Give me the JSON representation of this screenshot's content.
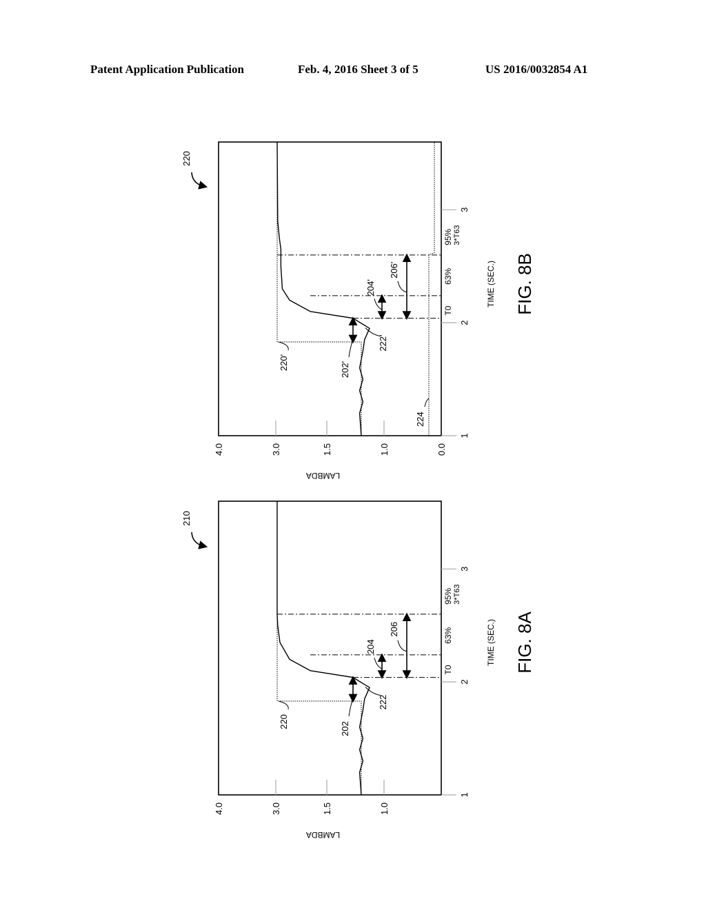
{
  "header": {
    "publication": "Patent Application Publication",
    "date_sheet": "Feb. 4, 2016   Sheet 3 of 5",
    "number": "US 2016/0032854 A1"
  },
  "chart_data": [
    {
      "type": "line",
      "figure": "FIG. 8B",
      "ref": "220",
      "orientation": "rotated 90 degrees counter-clockwise",
      "xlabel": "TIME (SEC.)",
      "ylabel": "LAMBDA",
      "x_ticks": [
        "1",
        "2",
        "3"
      ],
      "y_ticks": [
        "4.0",
        "3.0",
        "1.5",
        "1.0",
        "0.0"
      ],
      "xlim": [
        1,
        3.6
      ],
      "markers": [
        {
          "label": "T0",
          "x": 2.04
        },
        {
          "label": "63%",
          "x": 2.24
        },
        {
          "label": "95%",
          "sub": "3*T63",
          "x": 2.6
        }
      ],
      "series": [
        {
          "name": "220'",
          "style": "dotted",
          "points": [
            [
              1,
              1.2
            ],
            [
              1.83,
              1.2
            ],
            [
              1.83,
              2.9
            ],
            [
              3.6,
              2.9
            ]
          ]
        },
        {
          "name": "222'",
          "style": "solid",
          "points": [
            [
              1,
              1.2
            ],
            [
              1.2,
              1.22
            ],
            [
              1.3,
              1.18
            ],
            [
              1.4,
              1.22
            ],
            [
              1.5,
              1.18
            ],
            [
              1.6,
              1.22
            ],
            [
              1.75,
              1.18
            ],
            [
              1.85,
              1.16
            ],
            [
              1.95,
              1.1
            ],
            [
              2.04,
              1.3
            ],
            [
              2.1,
              2.2
            ],
            [
              2.2,
              2.6
            ],
            [
              2.3,
              2.75
            ],
            [
              2.5,
              2.78
            ],
            [
              2.65,
              2.78
            ],
            [
              2.75,
              2.82
            ],
            [
              2.9,
              2.88
            ],
            [
              3.6,
              2.9
            ]
          ]
        },
        {
          "name": "224",
          "style": "dotted",
          "points": [
            [
              1,
              0.2
            ],
            [
              1.2,
              0.2
            ],
            [
              1.2,
              0.2
            ],
            [
              2.6,
              0.2
            ],
            [
              2.62,
              0.05
            ],
            [
              3.6,
              0.05
            ]
          ]
        }
      ],
      "annotations": [
        "202'",
        "204'",
        "206'",
        "220'",
        "222'",
        "224"
      ]
    },
    {
      "type": "line",
      "figure": "FIG. 8A",
      "ref": "210",
      "orientation": "rotated 90 degrees counter-clockwise",
      "xlabel": "TIME (SEC.)",
      "ylabel": "LAMBDA",
      "x_ticks": [
        "1",
        "2",
        "3"
      ],
      "y_ticks": [
        "4.0",
        "3.0",
        "1.5",
        "1.0"
      ],
      "xlim": [
        1,
        3.6
      ],
      "markers": [
        {
          "label": "T0",
          "x": 2.04
        },
        {
          "label": "63%",
          "x": 2.24
        },
        {
          "label": "95%",
          "sub": "3*T63",
          "x": 2.6
        }
      ],
      "series": [
        {
          "name": "220",
          "style": "dotted",
          "points": [
            [
              1,
              1.2
            ],
            [
              1.83,
              1.2
            ],
            [
              1.83,
              2.9
            ],
            [
              3.6,
              2.9
            ]
          ]
        },
        {
          "name": "222",
          "style": "solid",
          "points": [
            [
              1,
              1.2
            ],
            [
              1.2,
              1.22
            ],
            [
              1.3,
              1.18
            ],
            [
              1.4,
              1.22
            ],
            [
              1.5,
              1.18
            ],
            [
              1.6,
              1.22
            ],
            [
              1.75,
              1.18
            ],
            [
              1.85,
              1.16
            ],
            [
              1.95,
              1.1
            ],
            [
              2.04,
              1.3
            ],
            [
              2.1,
              2.2
            ],
            [
              2.2,
              2.6
            ],
            [
              2.35,
              2.8
            ],
            [
              2.5,
              2.88
            ],
            [
              2.6,
              2.9
            ],
            [
              3.6,
              2.9
            ]
          ]
        }
      ],
      "annotations": [
        "202",
        "204",
        "206",
        "220",
        "222"
      ]
    }
  ]
}
